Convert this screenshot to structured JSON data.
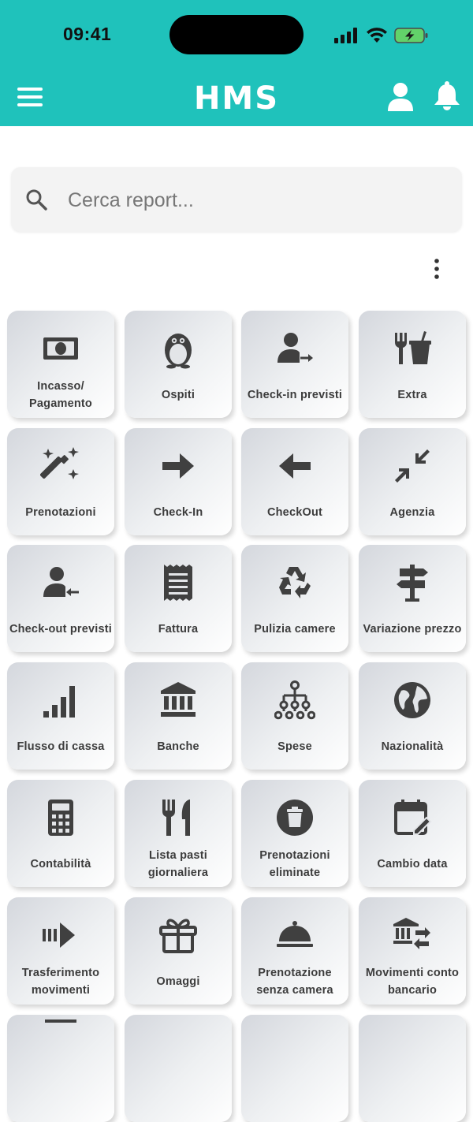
{
  "status_bar": {
    "time": "09:41"
  },
  "app": {
    "logo_text": "HMS"
  },
  "search": {
    "placeholder": "Cerca report..."
  },
  "colors": {
    "header": "#1fc2bb",
    "icon": "#404040",
    "tile_text": "#3c3c3c"
  },
  "tiles": [
    {
      "label": "Incasso/\nPagamento",
      "icon": "cash-icon"
    },
    {
      "label": "Ospiti",
      "icon": "penguin-icon"
    },
    {
      "label": "Check-in previsti",
      "icon": "user-arrow-right-icon"
    },
    {
      "label": "Extra",
      "icon": "utensils-drink-icon"
    },
    {
      "label": "Prenotazioni",
      "icon": "magic-wand-icon"
    },
    {
      "label": "Check-In",
      "icon": "arrow-right-icon"
    },
    {
      "label": "CheckOut",
      "icon": "arrow-left-icon"
    },
    {
      "label": "Agenzia",
      "icon": "compress-icon"
    },
    {
      "label": "Check-out previsti",
      "icon": "user-arrow-left-icon"
    },
    {
      "label": "Fattura",
      "icon": "receipt-icon"
    },
    {
      "label": "Pulizia camere",
      "icon": "recycle-icon"
    },
    {
      "label": "Variazione prezzo",
      "icon": "signpost-icon"
    },
    {
      "label": "Flusso di cassa",
      "icon": "signal-bars-icon"
    },
    {
      "label": "Banche",
      "icon": "bank-icon"
    },
    {
      "label": "Spese",
      "icon": "org-chart-icon"
    },
    {
      "label": "Nazionalità",
      "icon": "globe-icon"
    },
    {
      "label": "Contabilità",
      "icon": "calculator-icon"
    },
    {
      "label": "Lista pasti\ngiornaliera",
      "icon": "fork-knife-icon"
    },
    {
      "label": "Prenotazioni\neliminate",
      "icon": "trash-circle-icon"
    },
    {
      "label": "Cambio data",
      "icon": "calendar-edit-icon"
    },
    {
      "label": "Trasferimento\nmovimenti",
      "icon": "transfer-arrow-icon"
    },
    {
      "label": "Omaggi",
      "icon": "gift-icon"
    },
    {
      "label": "Prenotazione\nsenza camera",
      "icon": "cloche-icon"
    },
    {
      "label": "Movimenti conto\nbancario",
      "icon": "bank-transfer-icon"
    }
  ]
}
